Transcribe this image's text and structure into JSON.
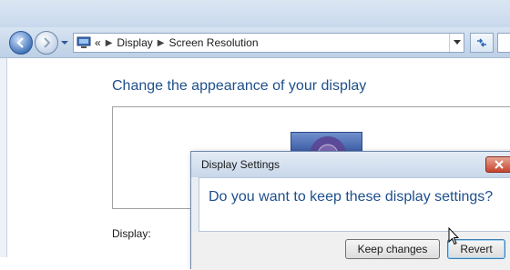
{
  "navigation": {
    "back_icon": "back-arrow-icon",
    "forward_icon": "forward-arrow-icon",
    "recent_icon": "chevron-down-icon",
    "address": {
      "icon": "control-panel-icon",
      "overflow": "«",
      "breadcrumbs": [
        "Display",
        "Screen Resolution"
      ],
      "separator_icon": "breadcrumb-arrow-icon"
    },
    "refresh_icon": "refresh-icon"
  },
  "main": {
    "title": "Change the appearance of your display",
    "display_label": "Display:"
  },
  "dialog": {
    "title": "Display Settings",
    "message": "Do you want to keep these display settings?",
    "keep_label": "Keep changes",
    "revert_label": "Revert",
    "close_icon": "close-icon"
  },
  "colors": {
    "title_blue": "#1e4f8c",
    "close_red": "#c5452f",
    "focus_blue": "#3c7fb1"
  }
}
